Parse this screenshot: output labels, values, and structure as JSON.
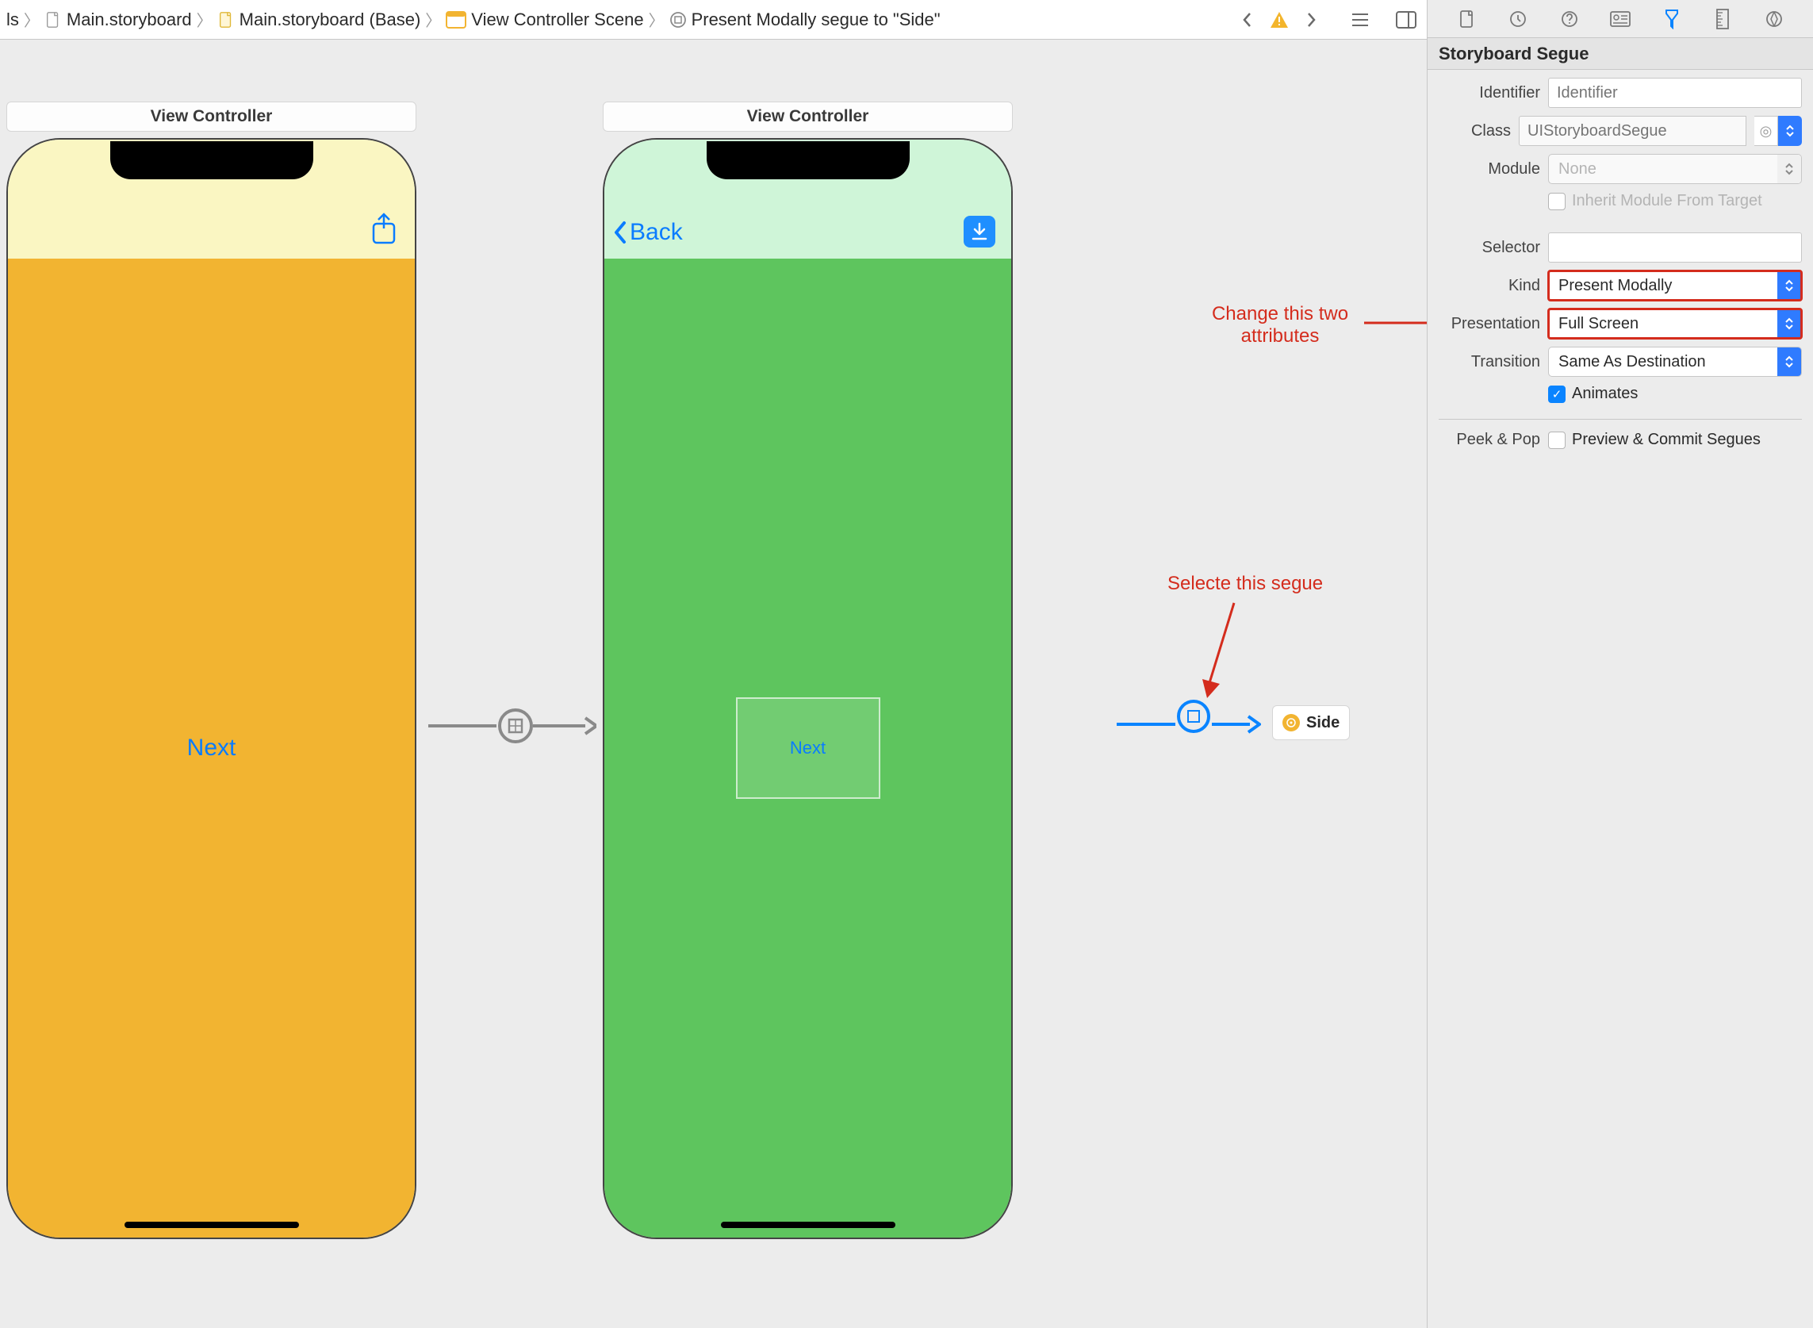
{
  "breadcrumb": {
    "item0": "ls",
    "item1": "Main.storyboard",
    "item2": "Main.storyboard (Base)",
    "item3": "View Controller Scene",
    "item4": "Present Modally segue to \"Side\""
  },
  "scene1": {
    "title": "View Controller",
    "next": "Next"
  },
  "scene2": {
    "title": "View Controller",
    "back": "Back",
    "next": "Next"
  },
  "side_box": "Side",
  "annotations": {
    "attr": "Change this two attributes",
    "segue": "Selecte this segue"
  },
  "inspector": {
    "title": "Storyboard Segue",
    "labels": {
      "identifier": "Identifier",
      "class": "Class",
      "module": "Module",
      "inherit": "Inherit Module From Target",
      "selector": "Selector",
      "kind": "Kind",
      "presentation": "Presentation",
      "transition": "Transition",
      "animates": "Animates",
      "peek": "Peek & Pop",
      "preview": "Preview & Commit Segues"
    },
    "placeholders": {
      "identifier": "Identifier",
      "class": "UIStoryboardSegue",
      "module": "None"
    },
    "values": {
      "kind": "Present Modally",
      "presentation": "Full Screen",
      "transition": "Same As Destination"
    }
  }
}
